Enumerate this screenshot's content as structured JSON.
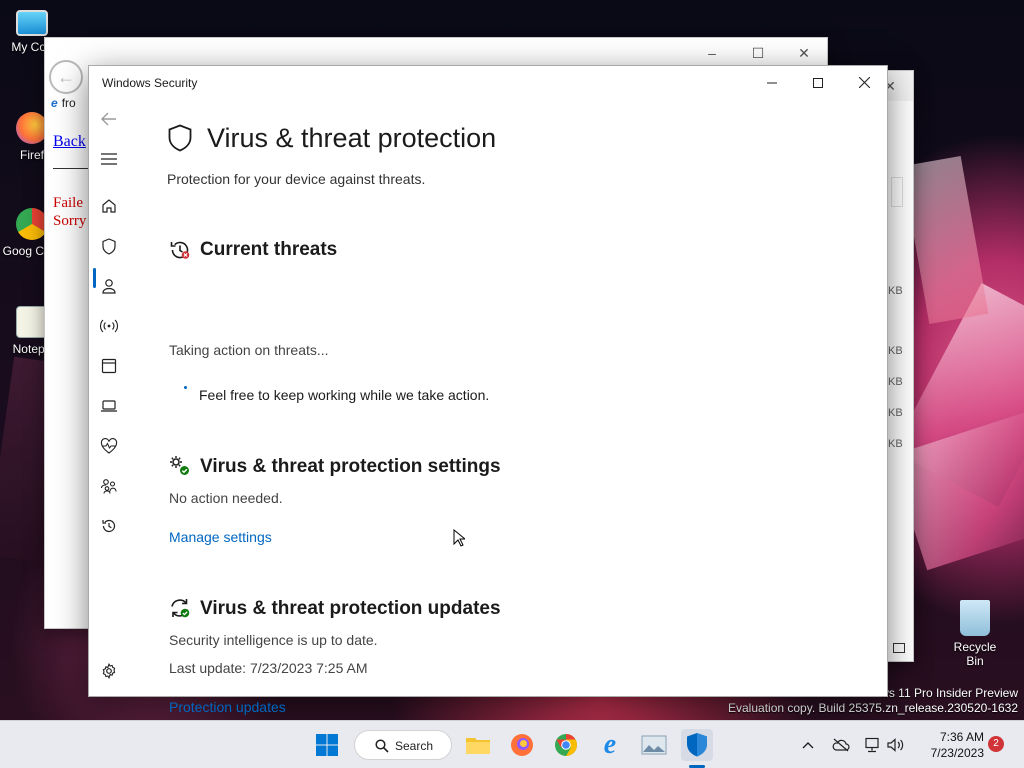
{
  "window": {
    "title": "Windows Security"
  },
  "page": {
    "title": "Virus & threat protection",
    "subtitle": "Protection for your device against threats."
  },
  "current_threats": {
    "title": "Current threats",
    "status": "Taking action on threats...",
    "note": "Feel free to keep working while we take action."
  },
  "settings": {
    "title": "Virus & threat protection settings",
    "status": "No action needed.",
    "link": "Manage settings"
  },
  "updates": {
    "title": "Virus & threat protection updates",
    "status": "Security intelligence is up to date.",
    "last_update": "Last update: 7/23/2023 7:25 AM",
    "link": "Protection updates"
  },
  "desktop": {
    "icons": [
      "My Con",
      "Firef",
      "Goog Chro",
      "Notepa",
      "Recycle Bin"
    ],
    "watermark_line1": "ws 11 Pro Insider Preview",
    "watermark_line2": "Evaluation copy. Build 25375.zn_release.230520-1632"
  },
  "background_browser": {
    "url_fragment": "fro",
    "back_link": "Back",
    "error_text": "Faile Sorry"
  },
  "background_explorer": {
    "size_labels": [
      "KB",
      "KB",
      "KB",
      "KB",
      "KB"
    ]
  },
  "taskbar": {
    "search_label": "Search",
    "time": "7:36 AM",
    "date": "7/23/2023",
    "notification_count": "2"
  },
  "colors": {
    "accent": "#0067c0",
    "badge": "#d13438"
  }
}
